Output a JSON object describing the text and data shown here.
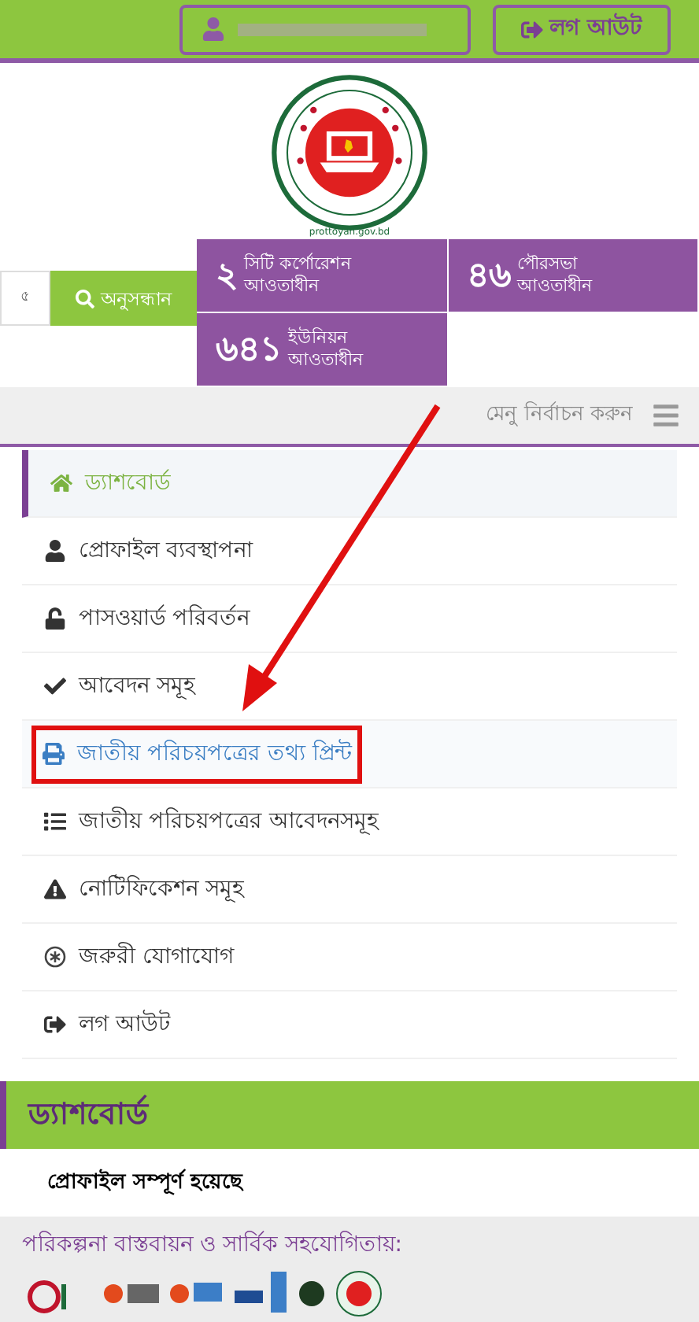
{
  "top_bar": {
    "logout_button": "লগ আউট"
  },
  "logo": {
    "caption": "prottoyan.gov.bd"
  },
  "search": {
    "value": "৫",
    "button": "অনুসন্ধান"
  },
  "stats": [
    {
      "number": "২",
      "line1": "সিটি কর্পোরেশন",
      "line2": "আওতাধীন"
    },
    {
      "number": "৪৬",
      "line1": "পৌরসভা",
      "line2": "আওতাধীন"
    },
    {
      "number": "৬৪১",
      "line1": "ইউনিয়ন",
      "line2": "আওতাধীন"
    }
  ],
  "menu_bar": {
    "label": "মেনু নির্বাচন করুন"
  },
  "menu": [
    {
      "label": "ড্যাশবোর্ড",
      "selected": true,
      "hovered": false,
      "annotated": false
    },
    {
      "label": "প্রোফাইল ব্যবস্থাপনা",
      "selected": false,
      "hovered": false,
      "annotated": false
    },
    {
      "label": "পাসওয়ার্ড পরিবর্তন",
      "selected": false,
      "hovered": false,
      "annotated": false
    },
    {
      "label": "আবেদন সমূহ",
      "selected": false,
      "hovered": false,
      "annotated": false
    },
    {
      "label": "জাতীয় পরিচয়পত্রের তথ্য প্রিন্ট",
      "selected": false,
      "hovered": true,
      "annotated": true
    },
    {
      "label": "জাতীয় পরিচয়পত্রের আবেদনসমূহ",
      "selected": false,
      "hovered": false,
      "annotated": false
    },
    {
      "label": "নোটিফিকেশন সমূহ",
      "selected": false,
      "hovered": false,
      "annotated": false
    },
    {
      "label": "জরুরী যোগাযোগ",
      "selected": false,
      "hovered": false,
      "annotated": false
    },
    {
      "label": "লগ আউট",
      "selected": false,
      "hovered": false,
      "annotated": false
    }
  ],
  "dashboard": {
    "title": "ড্যাশবোর্ড",
    "status": "প্রোফাইল সম্পূর্ণ হয়েছে"
  },
  "footer": {
    "text": "পরিকল্পনা বাস্তবায়ন ও সার্বিক সহযোগিতায়:"
  }
}
